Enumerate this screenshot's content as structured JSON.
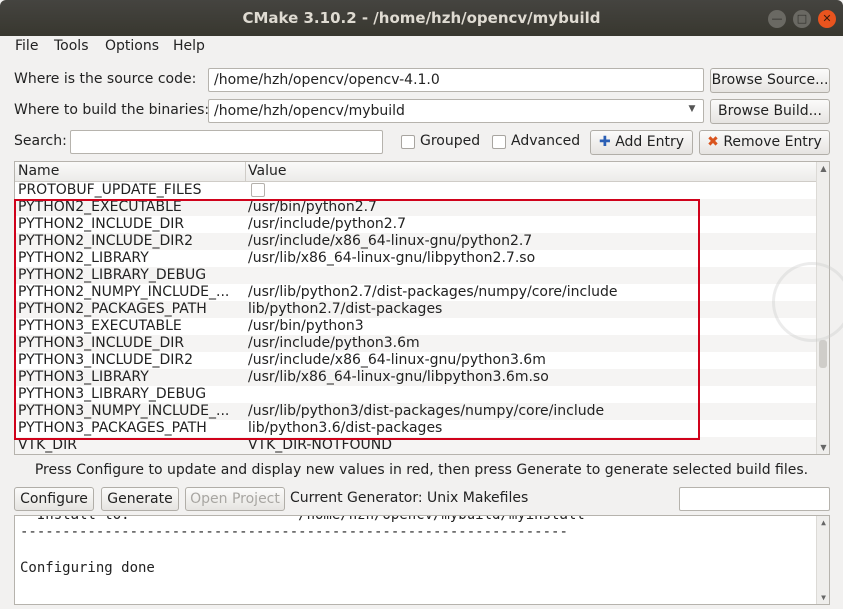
{
  "window": {
    "title": "CMake 3.10.2 - /home/hzh/opencv/mybuild"
  },
  "menu": [
    "File",
    "Tools",
    "Options",
    "Help"
  ],
  "source": {
    "label": "Where is the source code:",
    "value": "/home/hzh/opencv/opencv-4.1.0",
    "browse_label": "Browse Source..."
  },
  "build": {
    "label": "Where to build the binaries:",
    "value": "/home/hzh/opencv/mybuild",
    "browse_label": "Browse Build..."
  },
  "search": {
    "label": "Search:",
    "value": "",
    "grouped_label": "Grouped",
    "advanced_label": "Advanced",
    "add_entry_label": "Add Entry",
    "remove_entry_label": "Remove Entry"
  },
  "table": {
    "columns": [
      "Name",
      "Value"
    ],
    "rows": [
      {
        "name": "PROTOBUF_UPDATE_FILES",
        "value": "",
        "checkbox": true
      },
      {
        "name": "PYTHON2_EXECUTABLE",
        "value": "/usr/bin/python2.7"
      },
      {
        "name": "PYTHON2_INCLUDE_DIR",
        "value": "/usr/include/python2.7"
      },
      {
        "name": "PYTHON2_INCLUDE_DIR2",
        "value": "/usr/include/x86_64-linux-gnu/python2.7"
      },
      {
        "name": "PYTHON2_LIBRARY",
        "value": "/usr/lib/x86_64-linux-gnu/libpython2.7.so"
      },
      {
        "name": "PYTHON2_LIBRARY_DEBUG",
        "value": ""
      },
      {
        "name": "PYTHON2_NUMPY_INCLUDE_...",
        "value": "/usr/lib/python2.7/dist-packages/numpy/core/include"
      },
      {
        "name": "PYTHON2_PACKAGES_PATH",
        "value": "lib/python2.7/dist-packages"
      },
      {
        "name": "PYTHON3_EXECUTABLE",
        "value": "/usr/bin/python3"
      },
      {
        "name": "PYTHON3_INCLUDE_DIR",
        "value": "/usr/include/python3.6m"
      },
      {
        "name": "PYTHON3_INCLUDE_DIR2",
        "value": "/usr/include/x86_64-linux-gnu/python3.6m"
      },
      {
        "name": "PYTHON3_LIBRARY",
        "value": "/usr/lib/x86_64-linux-gnu/libpython3.6m.so"
      },
      {
        "name": "PYTHON3_LIBRARY_DEBUG",
        "value": ""
      },
      {
        "name": "PYTHON3_NUMPY_INCLUDE_...",
        "value": "/usr/lib/python3/dist-packages/numpy/core/include"
      },
      {
        "name": "PYTHON3_PACKAGES_PATH",
        "value": "lib/python3.6/dist-packages"
      },
      {
        "name": "VTK_DIR",
        "value": "VTK_DIR-NOTFOUND"
      }
    ]
  },
  "hint": "Press Configure to update and display new values in red, then press Generate to generate selected build files.",
  "actions": {
    "configure_label": "Configure",
    "generate_label": "Generate",
    "open_project_label": "Open Project",
    "generator_text": "Current Generator: Unix Makefiles",
    "generator_field_value": ""
  },
  "output": {
    "lines": [
      "  Install to:                    /home/hzh/opencv/mybuild/myinstall",
      "-----------------------------------------------------------------",
      "",
      "Configuring done"
    ]
  },
  "colors": {
    "highlight_border": "#d0021b",
    "titlebar": "#3c3b37",
    "close_button": "#e9541e"
  }
}
